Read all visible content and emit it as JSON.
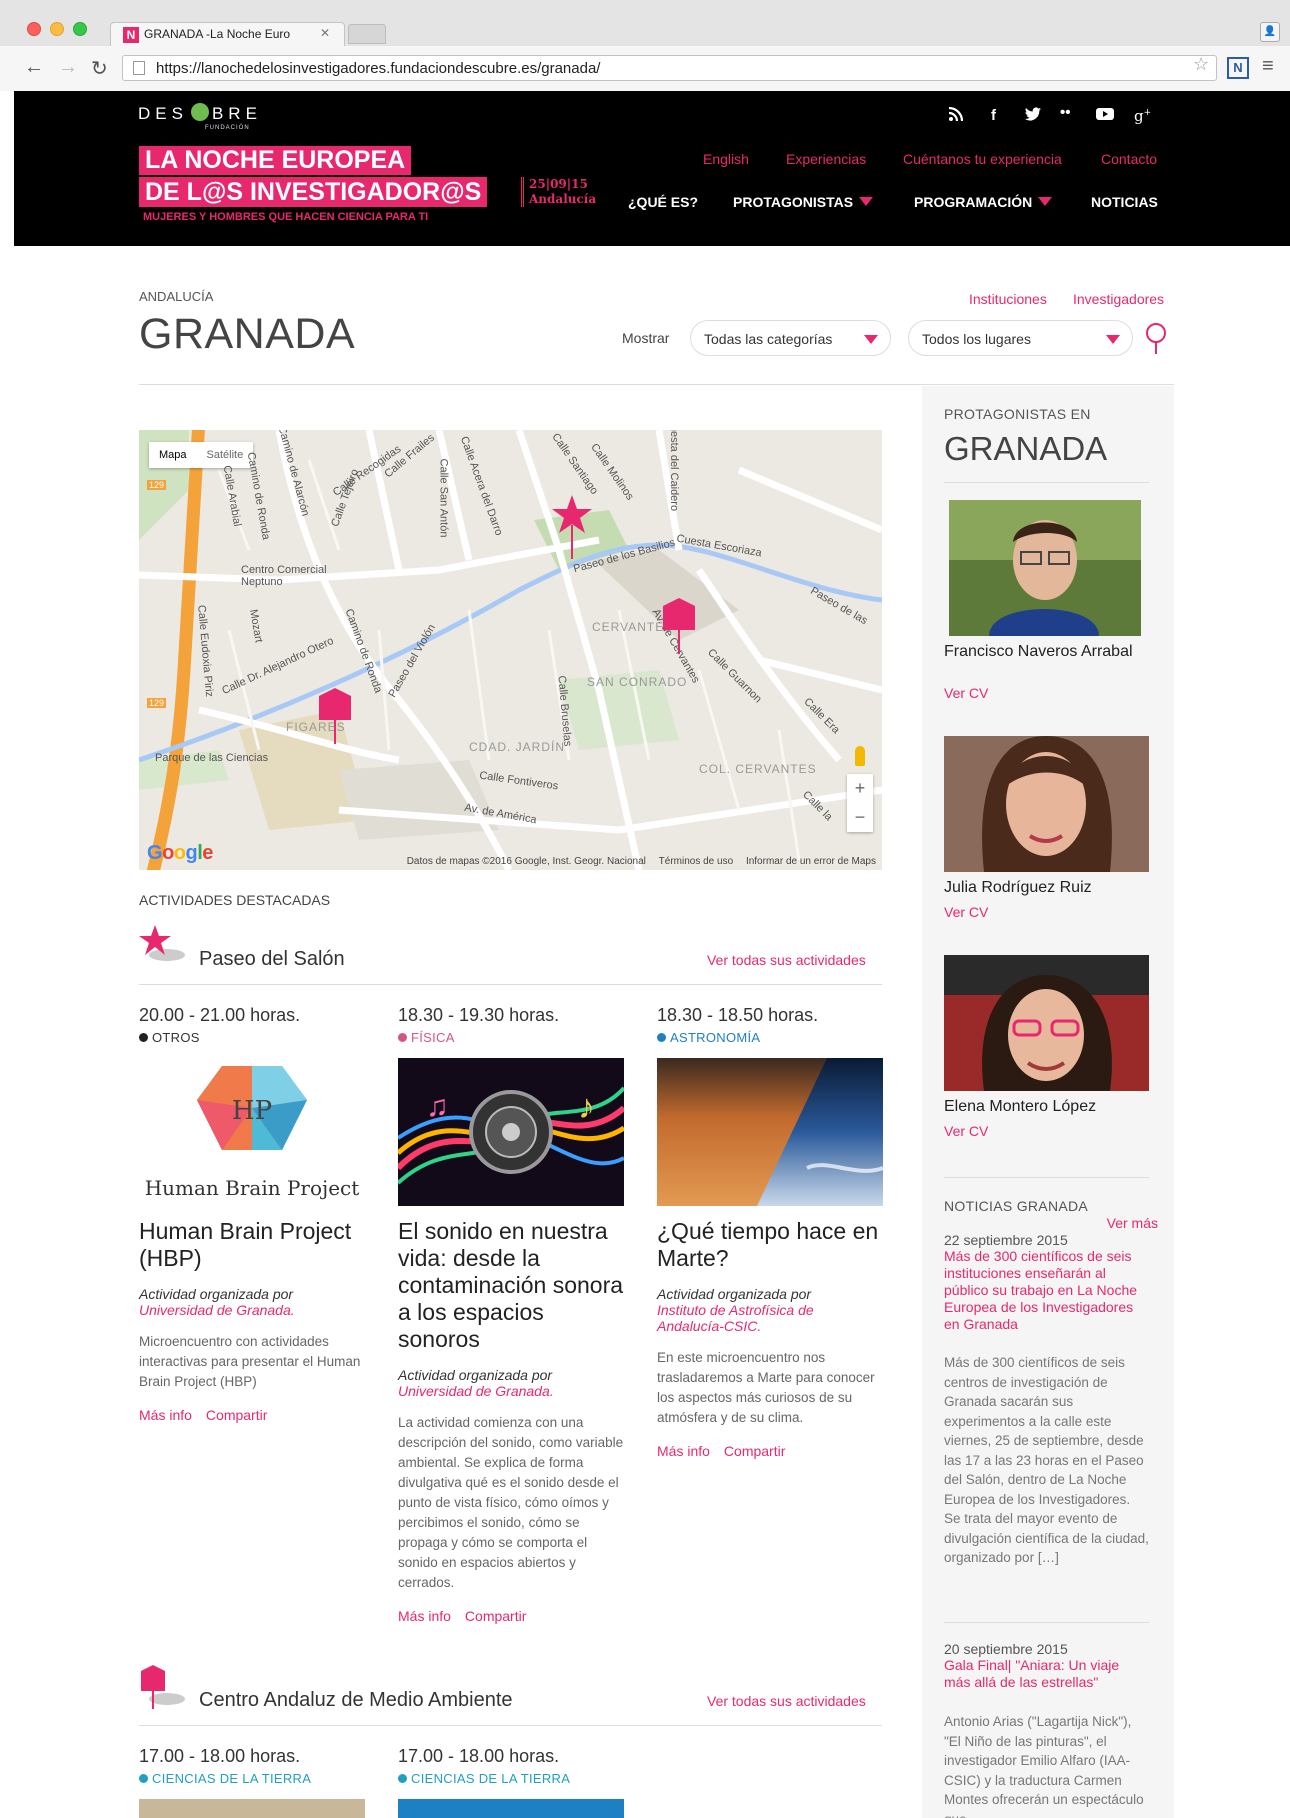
{
  "browser": {
    "tab_title": "GRANADA -La Noche Euro",
    "tab_favicon": "N",
    "url": "https://lanochedelosinvestigadores.fundaciondescubre.es/granada/"
  },
  "site": {
    "logo_text_left": "DES",
    "logo_text_right": "BRE",
    "logo_sub": "FUNDACIÓN",
    "brand_line1": "LA NOCHE EUROPEA",
    "brand_line2": "DE L@S INVESTIGADOR@S",
    "brand_date_line1": "25|09|15",
    "brand_date_line2": "Andalucía",
    "brand_tagline": "MUJERES Y HOMBRES QUE HACEN CIENCIA PARA TI",
    "top_links": [
      "English",
      "Experiencias",
      "Cuéntanos tu experiencia",
      "Contacto"
    ],
    "nav": [
      "¿QUÉ ES?",
      "PROTAGONISTAS",
      "PROGRAMACIÓN",
      "NOTICIAS"
    ],
    "social_icons": [
      "rss-icon",
      "facebook-icon",
      "twitter-icon",
      "flickr-icon",
      "youtube-icon",
      "google-plus-icon"
    ],
    "accent": "#e8286e"
  },
  "page": {
    "region": "ANDALUCÍA",
    "title": "GRANADA",
    "links": [
      "Instituciones",
      "Investigadores"
    ],
    "filter_label": "Mostrar",
    "filter_category": "Todas las categorías",
    "filter_place": "Todos los lugares"
  },
  "map": {
    "toggle_map": "Mapa",
    "toggle_satellite": "Satélite",
    "google": "Google",
    "footer_data": "Datos de mapas ©2016 Google, Inst. Geogr. Nacional",
    "footer_terms": "Términos de uso",
    "footer_report": "Informar de un error de Maps",
    "labels": {
      "centro_comercial": "Centro Comercial Neptuno",
      "parque": "Parque de las Ciencias",
      "paseo_basilios": "Paseo de los Basilios",
      "cuesta_escoriaza": "Cuesta Escoriaza",
      "cervantes": "CERVANTES",
      "san_conrado": "SAN CONRADO",
      "figares": "FIGARES",
      "cdad_jardin": "CDAD. JARDÍN",
      "col_cervantes": "COL. CERVANTES",
      "calle_fontiveros": "Calle Fontiveros",
      "av_america": "Av. de América",
      "calle_recogidas": "Calle Recogidas",
      "calle_frailes": "Calle Frailes",
      "calle_san_anton": "Calle San Antón",
      "acera_darro": "Calle Acera del Darro",
      "camino_ronda": "Camino de Ronda",
      "paseo_violon": "Paseo del Violón",
      "alejandro_otero": "Calle Dr. Alejandro Otero",
      "calle_mozart": "Mozart",
      "eudoxia_piriz": "Calle Eudoxia Piriz",
      "calle_tejeiro": "Calle Tejeiro",
      "calle_santiago": "Calle Santiago",
      "calle_molinos": "Calle Molinos",
      "cuesta_caidero": "Cuesta del Caidero",
      "av_cervantes": "Av. de Cervantes",
      "calle_guarnon": "Calle Guarnon",
      "calle_bruselas": "Calle Bruselas",
      "paseo_de_las": "Paseo de las",
      "calle_era": "Calle Era",
      "calle_arabial": "Calle Arabial",
      "camino_alarcon": "Camino de Alarcón",
      "calle_la": "Calle la",
      "road_129": "129",
      "road_129b": "129"
    }
  },
  "activities": {
    "heading": "ACTIVIDADES DESTACADAS",
    "see_all": "Ver todas sus actividades",
    "more_info": "Más info",
    "share": "Compartir",
    "organized_by": "Actividad organizada por",
    "venues": [
      {
        "name": "Paseo del Salón",
        "cards": [
          {
            "time": "20.00 - 21.00 horas.",
            "category": "OTROS",
            "category_color": "#222222",
            "image_text": "Human Brain Project",
            "title": "Human Brain Project (HBP)",
            "org": "Universidad de Granada.",
            "desc": "Microencuentro con actividades interactivas para presentar el Human Brain Project (HBP)"
          },
          {
            "time": "18.30 - 19.30 horas.",
            "category": "FÍSICA",
            "category_color": "#d4577f",
            "title": "El sonido en nuestra vida: desde la contaminación sonora a los espacios sonoros",
            "org": "Universidad de Granada.",
            "desc": "La actividad comienza con una descripción del sonido, como variable ambiental. Se explica de forma divulgativa qué es el sonido desde el punto de vista físico, cómo oímos y percibimos el sonido, cómo se propaga y cómo se comporta el sonido en espacios abiertos y cerrados."
          },
          {
            "time": "18.30 - 18.50 horas.",
            "category": "ASTRONOMÍA",
            "category_color": "#1f7fc1",
            "title": "¿Qué tiempo hace en Marte?",
            "org": "Instituto de Astrofísica de Andalucía-CSIC.",
            "desc": "En este microencuentro nos trasladaremos a Marte para conocer los aspectos más curiosos de su atmósfera y de su clima."
          }
        ]
      },
      {
        "name": "Centro Andaluz de Medio Ambiente",
        "cards": [
          {
            "time": "17.00 - 18.00 horas.",
            "category": "CIENCIAS DE LA TIERRA",
            "category_color": "#1f9fc1"
          },
          {
            "time": "17.00 - 18.00 horas.",
            "category": "CIENCIAS DE LA TIERRA",
            "category_color": "#1f9fc1"
          }
        ]
      }
    ]
  },
  "sidebar": {
    "label": "PROTAGONISTAS EN",
    "title": "GRANADA",
    "cv": "Ver CV",
    "people": [
      "Francisco Naveros Arrabal",
      "Julia Rodríguez Ruiz",
      "Elena Montero López"
    ],
    "news_label": "NOTICIAS GRANADA",
    "news_more": "Ver más",
    "news": [
      {
        "date": "22 septiembre 2015",
        "headline": "Más de 300 científicos de seis instituciones enseñarán al público su trabajo en La Noche Europea de los Investigadores en Granada",
        "body": "Más de 300 científicos de seis centros de investigación de Granada sacarán sus experimentos a la calle este viernes, 25 de septiembre, desde las 17 a las 23 horas en el Paseo del Salón, dentro de La Noche Europea de los Investigadores. Se trata del mayor evento de divulgación científica de la ciudad, organizado por […]"
      },
      {
        "date": "20 septiembre 2015",
        "headline": "Gala Final| \"Aniara: Un viaje más allá de las estrellas\"",
        "body": "Antonio Arias (\"Lagartija Nick\"), \"El Niño de las pinturas\", el investigador Emilio Alfaro (IAA-CSIC) y la traductura Carmen Montes ofrecerán un espectáculo que"
      }
    ]
  }
}
